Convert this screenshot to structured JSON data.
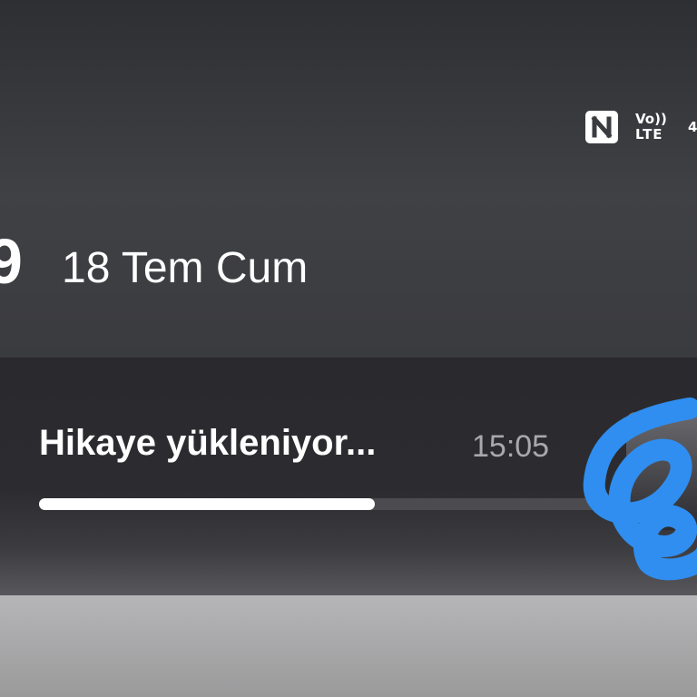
{
  "status_bar": {
    "nfc_icon": "nfc-icon",
    "volte_top": "Vo))",
    "volte_bottom": "LTE",
    "network_type_partial": "4"
  },
  "lockscreen": {
    "time_partial": "9",
    "date": "18 Tem Cum"
  },
  "notification": {
    "title": "Hikaye yükleniyor...",
    "time": "15:05",
    "progress_fraction": 0.56,
    "thumbnail": "story-thumbnail"
  },
  "colors": {
    "background_dark": "#3a3b3f",
    "notification_bg": "#2a2a2e",
    "progress_fill": "#ffffff",
    "progress_track": "#4c4c50",
    "secondary_text": "#a9a9ad",
    "scribble_blue": "#2f8ef0"
  }
}
